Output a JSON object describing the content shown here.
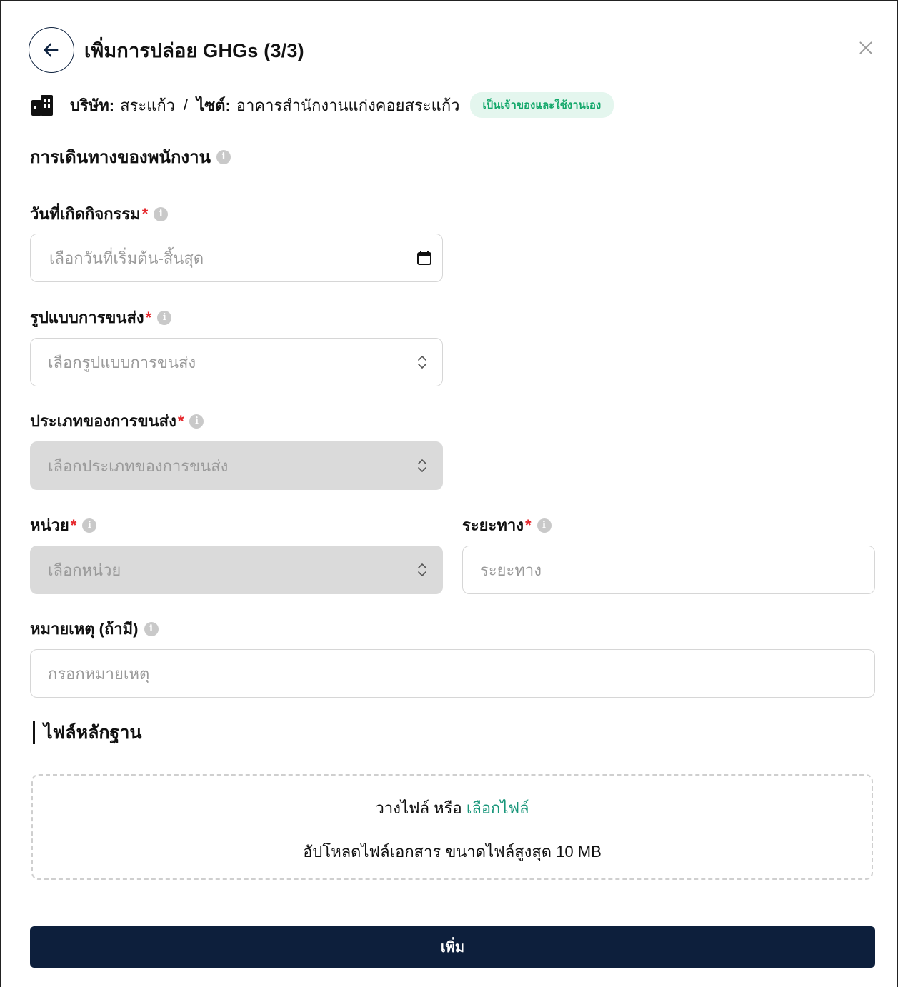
{
  "header": {
    "title": "เพิ่มการปล่อย GHGs  (3/3)"
  },
  "company": {
    "company_label": "บริษัท:",
    "company_value": "สระแก้ว",
    "separator": "/",
    "site_label": "ไซต์:",
    "site_value": "อาคารสำนักงานแก่งคอยสระแก้ว",
    "badge": "เป็นเจ้าของและใช้งานเอง",
    "badge_color": "#14a86b"
  },
  "section": {
    "title": "การเดินทางของพนักงาน"
  },
  "fields": {
    "activity_date": {
      "label": "วันที่เกิดกิจกรรม",
      "placeholder": "เลือกวันที่เริ่มต้น-สิ้นสุด",
      "icon": "calendar-icon"
    },
    "transport_mode": {
      "label": "รูปแบบการขนส่ง",
      "placeholder": "เลือกรูปแบบการขนส่ง",
      "icon": "chevron-updown-icon"
    },
    "transport_type": {
      "label": "ประเภทของการขนส่ง",
      "placeholder": "เลือกประเภทของการขนส่ง",
      "icon": "chevron-updown-icon"
    },
    "unit": {
      "label": "หน่วย",
      "placeholder": "เลือกหน่วย",
      "icon": "chevron-updown-icon"
    },
    "distance": {
      "label": "ระยะทาง",
      "placeholder": "ระยะทาง"
    },
    "note": {
      "label": "หมายเหตุ (ถ้ามี)",
      "placeholder": "กรอกหมายเหตุ"
    },
    "required_mark": "*"
  },
  "evidence": {
    "title": "ไฟล์หลักฐาน",
    "drop_text": "วางไฟล์ หรือ",
    "choose_link": "เลือกไฟล์",
    "hint": "อัปโหลดไฟล์เอกสาร ขนาดไฟล์สูงสุด 10 MB"
  },
  "submit": {
    "label": "เพิ่ม"
  },
  "colors": {
    "primary": "#0d1f3c",
    "required": "#e5262b",
    "link": "#18967a"
  }
}
